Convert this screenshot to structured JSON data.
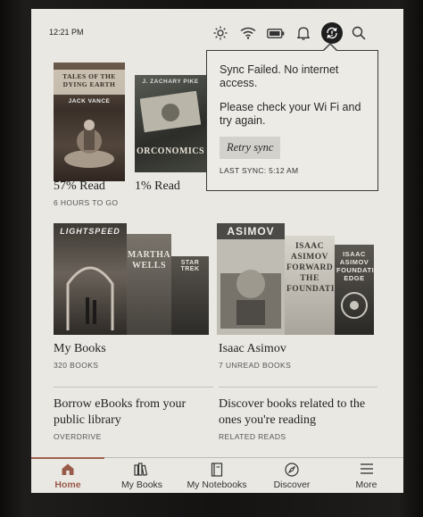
{
  "status": {
    "time": "12:21 PM"
  },
  "popup": {
    "message": "Sync Failed. No internet access.",
    "hint": "Please check your Wi Fi and try again.",
    "retry_label": "Retry sync",
    "last_sync": "LAST SYNC: 5:12 AM"
  },
  "books": [
    {
      "progress": "57% Read",
      "meta": "6 HOURS TO GO",
      "cover_title": "TALES OF THE DYING EARTH",
      "cover_author": "JACK VANCE"
    },
    {
      "progress": "1% Read",
      "meta": "",
      "cover_title": "ORCONOMICS",
      "cover_author": "J. ZACHARY PIKE"
    }
  ],
  "collections": [
    {
      "title": "My Books",
      "meta": "320 BOOKS",
      "covers": [
        "LIGHTSPEED",
        "MARTHA WELLS",
        "STAR TREK"
      ]
    },
    {
      "title": "Isaac Asimov",
      "meta": "7 UNREAD BOOKS",
      "covers": [
        "ASIMOV",
        "ISAAC ASIMOV FORWARD THE FOUNDATION",
        "ISAAC ASIMOV FOUNDATION'S EDGE"
      ]
    }
  ],
  "promos": [
    {
      "title": "Borrow eBooks from your public library",
      "meta": "OVERDRIVE"
    },
    {
      "title": "Discover books related to the ones you're reading",
      "meta": "RELATED READS"
    }
  ],
  "tabs": [
    {
      "label": "Home",
      "icon": "home-icon",
      "active": true
    },
    {
      "label": "My Books",
      "icon": "books-icon",
      "active": false
    },
    {
      "label": "My Notebooks",
      "icon": "notebook-icon",
      "active": false
    },
    {
      "label": "Discover",
      "icon": "compass-icon",
      "active": false
    },
    {
      "label": "More",
      "icon": "menu-icon",
      "active": false
    }
  ],
  "colors": {
    "accent": "#a06050",
    "screen": "#e9e8e3"
  }
}
